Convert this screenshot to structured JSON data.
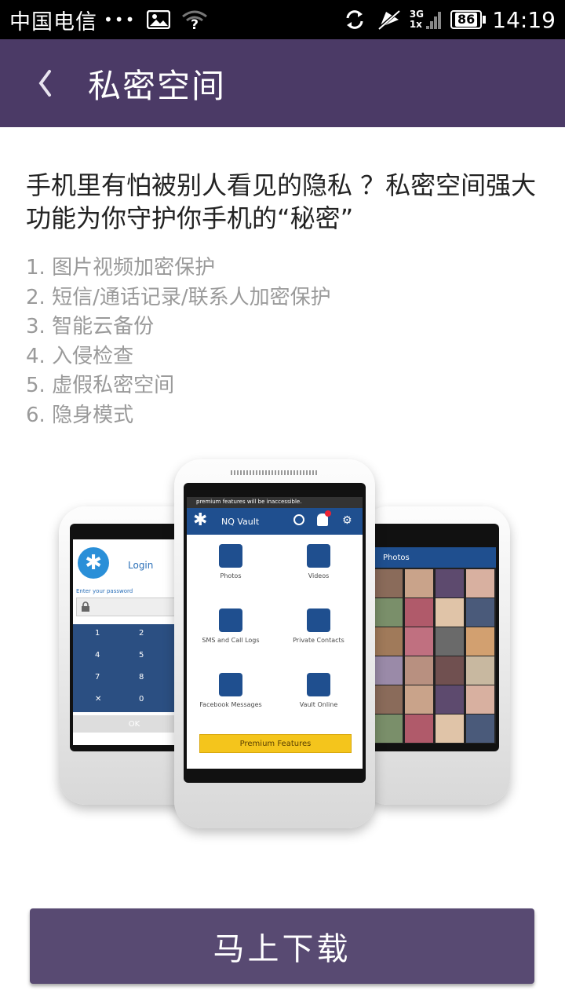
{
  "status_bar": {
    "carrier": "中国电信",
    "dots": "•••",
    "network": "3G",
    "network_sub": "1x",
    "battery": "86",
    "time": "14:19"
  },
  "header": {
    "back_icon": "chevron-left-icon",
    "title": "私密空间"
  },
  "intro": "手机里有怕被别人看见的隐私 ？私密空间强大功能为你守护你手机的“秘密”",
  "features": [
    "1. 图片视频加密保护",
    "2. 短信/通话记录/联系人加密保护",
    "3. 智能云备份",
    "4. 入侵检查",
    "5. 虚假私密空间",
    "6. 隐身模式"
  ],
  "illustration": {
    "banner": "premium features will be inaccessible.",
    "app_name": "NQ Vault",
    "grid": [
      "Photos",
      "Videos",
      "SMS and Call Logs",
      "Private Contacts",
      "Facebook Messages",
      "Vault Online"
    ],
    "premium": "Premium Features",
    "login": "Login",
    "password_hint": "Enter your password",
    "keys": [
      "1",
      "2",
      "4",
      "5",
      "7",
      "8",
      "✕",
      "0"
    ],
    "ok": "OK",
    "photos_title": "Photos"
  },
  "download_button": "马上下载",
  "colors": {
    "header_bg": "#4b3a66",
    "button_bg": "#584a72",
    "app_blue": "#1f4f8f",
    "premium_yellow": "#f4c51c"
  }
}
